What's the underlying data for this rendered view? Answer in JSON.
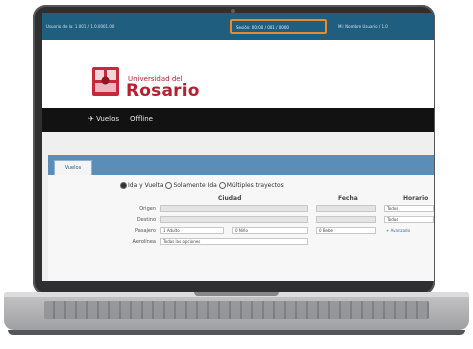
{
  "topbar": {
    "seg1": "Usuario de la: 1.001 / 1.0.0001.00",
    "seg2": "Sesión: 00:00 / 001 / 0000",
    "seg3": "Mi: Nombre Usuario / 1.0"
  },
  "brand": {
    "line1": "Universidad del",
    "line2": "Rosario"
  },
  "nav": {
    "items": [
      "Vuelos",
      "Offline"
    ]
  },
  "tab": {
    "label": "Vuelos"
  },
  "form": {
    "trip_options": [
      "Ida y Vuelta",
      "Solamente Ida",
      "Múltiples trayectos"
    ],
    "selected_trip": "Ida y Vuelta",
    "headers": {
      "city": "Ciudad",
      "date": "Fecha",
      "schedule": "Horario"
    },
    "rows": {
      "origin": "Origen",
      "destination": "Destino",
      "passengers": "Pasajero",
      "airline": "Aerolínea"
    },
    "passenger_selects": [
      "1 Adulto",
      "0 Niño",
      "0 Bebe"
    ],
    "schedule_values": [
      "Todos",
      "Todos"
    ],
    "airline_value": "Todas las opciones",
    "link_label": "+ Avanzado"
  }
}
